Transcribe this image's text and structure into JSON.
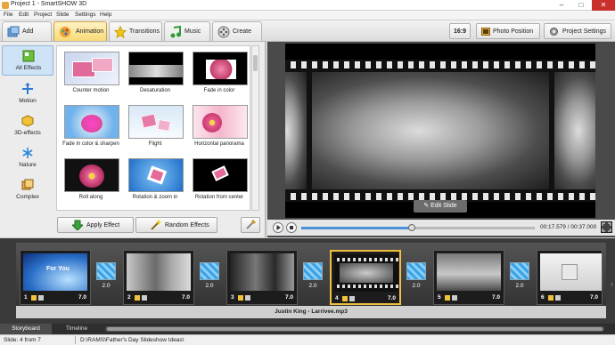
{
  "window": {
    "title": "Project 1 - SmartSHOW 3D"
  },
  "menu": [
    "File",
    "Edit",
    "Project",
    "Slide",
    "Settings",
    "Help"
  ],
  "tabs": [
    {
      "label": "Add",
      "icon": "add-icon"
    },
    {
      "label": "Animation",
      "icon": "animation-icon",
      "active": true
    },
    {
      "label": "Transitions",
      "icon": "star-icon"
    },
    {
      "label": "Music",
      "icon": "music-note-icon"
    },
    {
      "label": "Create",
      "icon": "film-reel-icon"
    }
  ],
  "right_toolbar": {
    "aspect": "16:9",
    "photo_position": "Photo Position",
    "project_settings": "Project Settings"
  },
  "categories": [
    {
      "label": "All Effects",
      "active": true
    },
    {
      "label": "Motion"
    },
    {
      "label": "3D-effects"
    },
    {
      "label": "Nature"
    },
    {
      "label": "Complex"
    }
  ],
  "effects": [
    {
      "label": "Counter motion"
    },
    {
      "label": "Desaturation"
    },
    {
      "label": "Fade in color"
    },
    {
      "label": "Fade in color & sharpen"
    },
    {
      "label": "Flight"
    },
    {
      "label": "Horizontal panorama"
    },
    {
      "label": "Roll along"
    },
    {
      "label": "Rotation & zoom in"
    },
    {
      "label": "Rotation from center"
    }
  ],
  "effect_buttons": {
    "apply": "Apply Effect",
    "random": "Random Effects"
  },
  "preview": {
    "edit_slide": "Edit Slide",
    "time": "00:17.579 / 00:37.000",
    "progress": 0.475
  },
  "slides": [
    {
      "num": "1",
      "duration": "7.0",
      "overlay": "For You"
    },
    {
      "num": "2",
      "duration": "7.0"
    },
    {
      "num": "3",
      "duration": "7.0"
    },
    {
      "num": "4",
      "duration": "7.0",
      "selected": true
    },
    {
      "num": "5",
      "duration": "7.0"
    },
    {
      "num": "6",
      "duration": "7.0"
    }
  ],
  "transitions": [
    "2.0",
    "2.0",
    "2.0",
    "2.0",
    "2.0"
  ],
  "audio_track": "Justin King - Larrivee.mp3",
  "bottom_tabs": {
    "storyboard": "Storyboard",
    "timeline": "Timeline"
  },
  "status": {
    "slide": "Slide: 4 from 7",
    "path": "D:\\RAMS\\Father's Day Slideshow Ideas\\"
  }
}
